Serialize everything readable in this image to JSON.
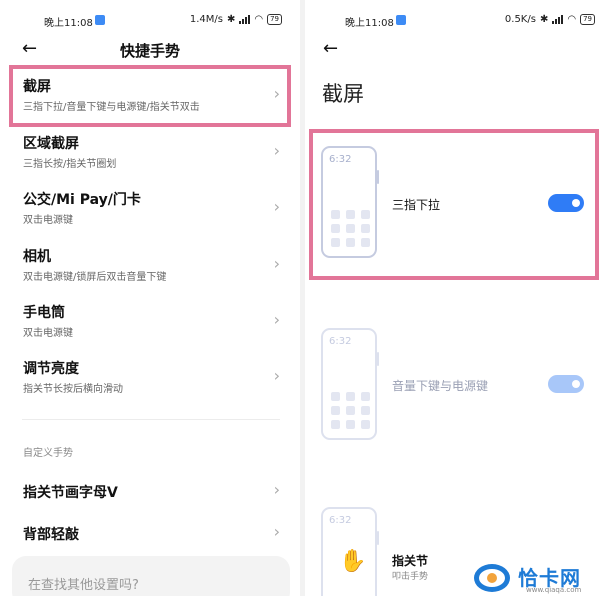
{
  "left": {
    "status": {
      "time": "晚上11:08",
      "net": "1.4M/s",
      "battery": "79"
    },
    "title": "快捷手势",
    "items": [
      {
        "title": "截屏",
        "subtitle": "三指下拉/音量下键与电源键/指关节双击"
      },
      {
        "title": "区域截屏",
        "subtitle": "三指长按/指关节圈划"
      },
      {
        "title": "公交/Mi Pay/门卡",
        "subtitle": "双击电源键"
      },
      {
        "title": "相机",
        "subtitle": "双击电源键/锁屏后双击音量下键"
      },
      {
        "title": "手电筒",
        "subtitle": "双击电源键"
      },
      {
        "title": "调节亮度",
        "subtitle": "指关节长按后横向滑动"
      }
    ],
    "section_label": "自定义手势",
    "custom_items": [
      {
        "title": "指关节画字母V"
      },
      {
        "title": "背部轻敲"
      }
    ],
    "search_placeholder": "在查找其他设置吗?"
  },
  "right": {
    "status": {
      "time": "晚上11:08",
      "net": "0.5K/s",
      "battery": "79"
    },
    "title": "截屏",
    "options": [
      {
        "phone_time": "6:32",
        "label": "三指下拉",
        "enabled": true
      },
      {
        "phone_time": "6:32",
        "label": "音量下键与电源键",
        "enabled": true
      },
      {
        "phone_time": "6:32",
        "label": "指关节",
        "sublabel": "叩击手势"
      }
    ]
  },
  "watermark": {
    "name": "恰卡网",
    "url": "www.qiaqa.com"
  },
  "colors": {
    "highlight": "#e27598",
    "toggle_on": "#2f7cf6",
    "watermark_blue": "#1e7bd6"
  }
}
